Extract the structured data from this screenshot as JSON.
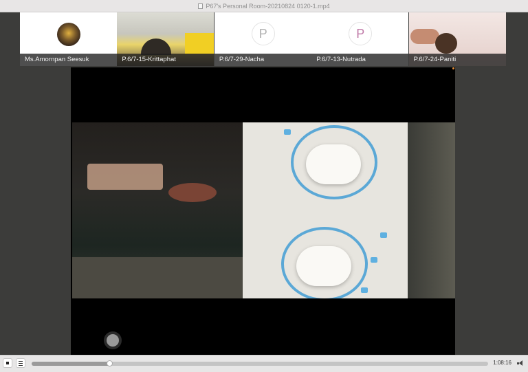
{
  "window": {
    "title": "P67's Personal Room-20210824 0120-1.mp4"
  },
  "participants": [
    {
      "name": "Ms.Amornpan Seesuk",
      "type": "avatar-photo"
    },
    {
      "name": "P.6/7-15-Krittaphat",
      "type": "camera"
    },
    {
      "name": "P.6/7-29-Nacha",
      "type": "initial",
      "initial": "P"
    },
    {
      "name": "P.6/7-13-Nutrada",
      "type": "initial",
      "initial": "P"
    },
    {
      "name": "P.6/7-24-Paniti",
      "type": "camera"
    }
  ],
  "player": {
    "time": "1:08:16",
    "progress_fraction": 0.17
  },
  "colors": {
    "accent_dial": "#5ba8d6",
    "indicator_dot": "#e28b34"
  },
  "icons": [
    "stop-icon",
    "list-icon",
    "volume-icon",
    "file-icon"
  ]
}
